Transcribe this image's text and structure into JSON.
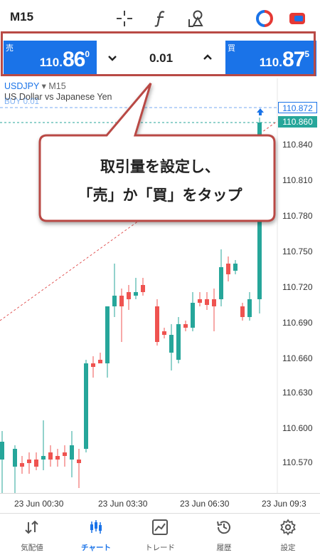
{
  "header": {
    "timeframe": "M15",
    "icons": [
      "crosshair-icon",
      "function-icon",
      "objects-icon",
      "one-click-trading-icon",
      "trade-toggle-icon"
    ]
  },
  "trade_panel": {
    "sell": {
      "label": "売",
      "price_main": "110.",
      "price_big": "86",
      "price_sup": "0"
    },
    "buy": {
      "label": "買",
      "price_main": "110.",
      "price_big": "87",
      "price_sup": "5"
    },
    "volume": "0.01"
  },
  "chart": {
    "symbol": "USDJPY",
    "timeframe_label": "M15",
    "description": "US Dollar vs Japanese Yen",
    "buy_level_label": "BUY 0.01",
    "price_labels": [
      "110.840",
      "110.810",
      "110.780",
      "110.750",
      "110.720",
      "110.690",
      "110.660",
      "110.630",
      "110.600",
      "110.570"
    ],
    "ask_tag": "110.872",
    "bid_tag": "110.860",
    "time_labels": [
      "23 Jun 00:30",
      "23 Jun 03:30",
      "23 Jun 06:30",
      "23 Jun 09:3"
    ],
    "colors": {
      "up": "#26a69a",
      "down": "#ef5350",
      "accent": "#1a73e8",
      "callout_border": "#b94a45"
    }
  },
  "callout": {
    "line1": "取引量を設定し、",
    "line2": "「売」か「買」をタップ"
  },
  "nav": {
    "items": [
      {
        "label": "気配値",
        "icon": "quotes-icon"
      },
      {
        "label": "チャート",
        "icon": "chart-icon"
      },
      {
        "label": "トレード",
        "icon": "trade-icon"
      },
      {
        "label": "履歴",
        "icon": "history-icon"
      },
      {
        "label": "設定",
        "icon": "settings-icon"
      }
    ],
    "active": "チャート"
  }
}
